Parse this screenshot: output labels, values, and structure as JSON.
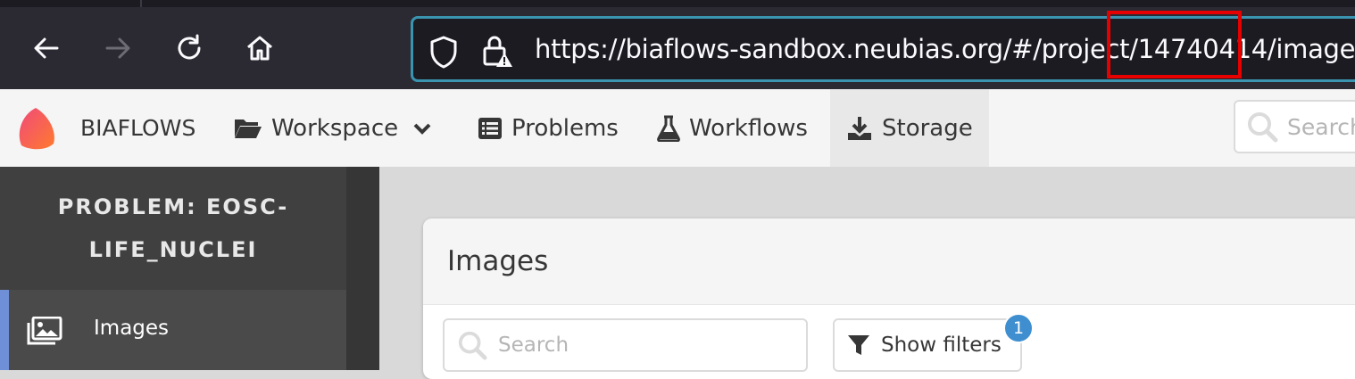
{
  "browser": {
    "url_prefix": "https://biaflows-sandbox.neubias.org/#/project/",
    "url_project_id": "14740414",
    "url_suffix": "/images",
    "highlight_color": "#e60000"
  },
  "navbar": {
    "brand": "BIAFLOWS",
    "items": [
      {
        "label": "Workspace",
        "icon": "folder-open-icon"
      },
      {
        "label": "Problems",
        "icon": "list-icon"
      },
      {
        "label": "Workflows",
        "icon": "flask-icon"
      },
      {
        "label": "Storage",
        "icon": "download-icon"
      }
    ],
    "search_placeholder": "Search"
  },
  "sidebar": {
    "title_line1": "PROBLEM: EOSC-",
    "title_line2": "LIFE_NUCLEI",
    "items": [
      {
        "label": "Images",
        "icon": "images-icon",
        "active": true
      }
    ]
  },
  "content": {
    "card_title": "Images",
    "search_placeholder": "Search",
    "filter_button": "Show filters",
    "filter_count": "1"
  }
}
